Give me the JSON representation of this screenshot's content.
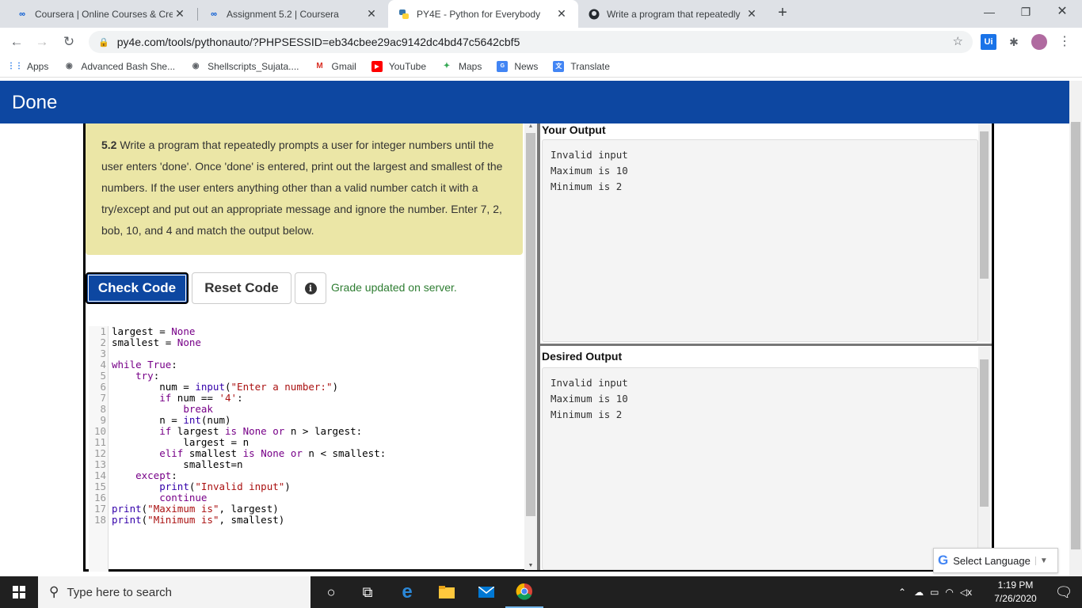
{
  "browser": {
    "tabs": [
      {
        "title": "Coursera | Online Courses & Cred",
        "icon": "coursera-icon",
        "active": false
      },
      {
        "title": "Assignment 5.2 | Coursera",
        "icon": "coursera-icon",
        "active": false
      },
      {
        "title": "PY4E - Python for Everybody",
        "icon": "python-icon",
        "active": true
      },
      {
        "title": "Write a program that repeatedly",
        "icon": "github-icon",
        "active": false
      }
    ],
    "new_tab_label": "+",
    "url": "py4e.com/tools/pythonauto/?PHPSESSID=eb34cbee29ac9142dc4bd47c5642cbf5",
    "bookmarks": [
      {
        "label": "Apps",
        "icon": "apps-grid-icon"
      },
      {
        "label": "Advanced Bash She...",
        "icon": "globe-icon"
      },
      {
        "label": "Shellscripts_Sujata....",
        "icon": "globe-icon"
      },
      {
        "label": "Gmail",
        "icon": "gmail-icon"
      },
      {
        "label": "YouTube",
        "icon": "youtube-icon"
      },
      {
        "label": "Maps",
        "icon": "maps-icon"
      },
      {
        "label": "News",
        "icon": "news-icon"
      },
      {
        "label": "Translate",
        "icon": "translate-icon"
      }
    ],
    "extension_label": "Ui"
  },
  "page": {
    "header_title": "Done",
    "prompt": {
      "number": "5.2",
      "lines": [
        "Write a program that repeatedly prompts a user for integer numbers until the",
        "user enters 'done'. Once 'done' is entered, print out the largest and smallest of the",
        "numbers. If the user enters anything other than a valid number catch it with a",
        "try/except and put out an appropriate message and ignore the number. Enter 7, 2,",
        "bob, 10, and 4 and match the output below."
      ]
    },
    "buttons": {
      "check_code": "Check Code",
      "reset_code": "Reset Code",
      "info_glyph": "i"
    },
    "grade_message": "Grade updated on server.",
    "code_lines": [
      {
        "n": "1",
        "text": "largest = None"
      },
      {
        "n": "2",
        "text": "smallest = None"
      },
      {
        "n": "3",
        "text": ""
      },
      {
        "n": "4",
        "text": "while True:"
      },
      {
        "n": "5",
        "text": "    try:"
      },
      {
        "n": "6",
        "text": "        num = input(\"Enter a number:\")"
      },
      {
        "n": "7",
        "text": "        if num == '4':"
      },
      {
        "n": "8",
        "text": "            break"
      },
      {
        "n": "9",
        "text": "        n = int(num)"
      },
      {
        "n": "10",
        "text": "        if largest is None or n > largest:"
      },
      {
        "n": "11",
        "text": "            largest = n"
      },
      {
        "n": "12",
        "text": "        elif smallest is None or n < smallest:"
      },
      {
        "n": "13",
        "text": "            smallest=n"
      },
      {
        "n": "14",
        "text": "    except:"
      },
      {
        "n": "15",
        "text": "        print(\"Invalid input\")"
      },
      {
        "n": "16",
        "text": "        continue"
      },
      {
        "n": "17",
        "text": "print(\"Maximum is\", largest)"
      },
      {
        "n": "18",
        "text": "print(\"Minimum is\", smallest)"
      }
    ],
    "your_output": {
      "heading": "Your Output",
      "text": "Invalid input\nMaximum is 10\nMinimum is 2"
    },
    "desired_output": {
      "heading": "Desired Output",
      "text": "Invalid input\nMaximum is 10\nMinimum is 2"
    },
    "translate_widget": {
      "label": "Select Language",
      "g_glyph": "G",
      "arrow": "▼"
    }
  },
  "taskbar": {
    "search_placeholder": "Type here to search",
    "time": "1:19 PM",
    "date": "7/26/2020"
  },
  "colors": {
    "header_blue": "#0d47a1",
    "prompt_bg": "#ebe6a6",
    "grade_green": "#2e7d32"
  }
}
